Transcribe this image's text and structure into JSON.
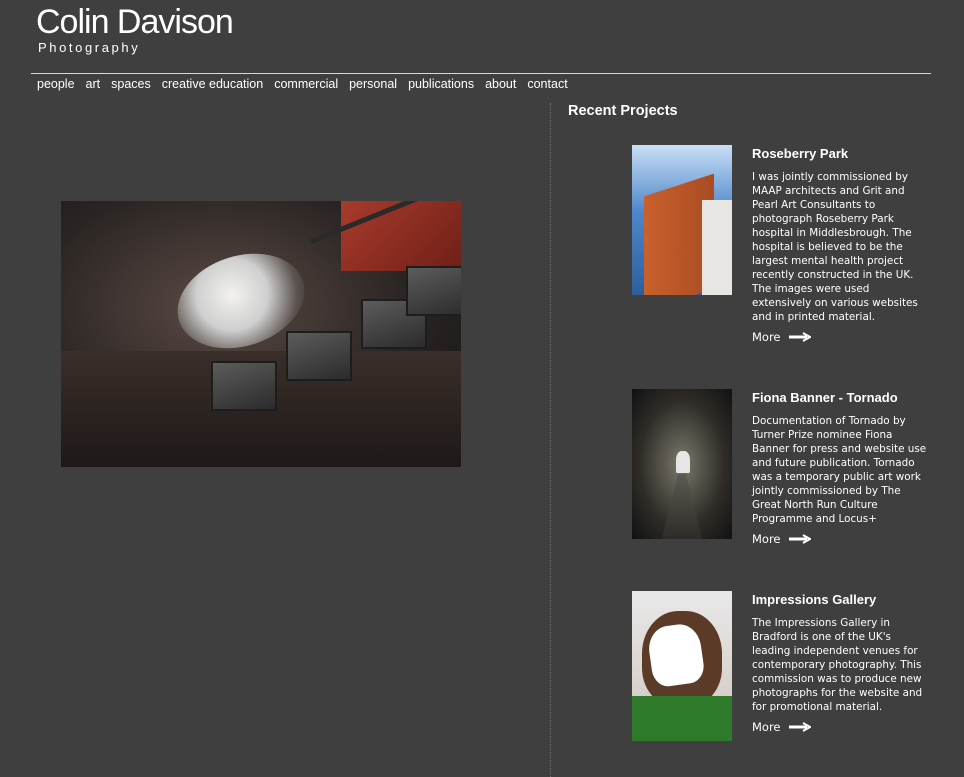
{
  "site": {
    "title": "Colin Davison",
    "subtitle": "Photography"
  },
  "nav": [
    "people",
    "art",
    "spaces",
    "creative education",
    "commercial",
    "personal",
    "publications",
    "about",
    "contact"
  ],
  "recent": {
    "heading": "Recent Projects",
    "more_label": "More",
    "projects": [
      {
        "title": "Roseberry Park",
        "desc": "I was jointly commissioned by MAAP architects and Grit and Pearl Art Consultants to photograph Roseberry Park hospital in Middlesbrough. The hospital is believed to be the largest mental health project recently constructed in the UK. The images were used extensively on various websites and in printed material."
      },
      {
        "title": "Fiona Banner - Tornado",
        "desc": "Documentation of Tornado by Turner Prize nominee Fiona Banner for press and website use and future publication. Tornado was a temporary public art work jointly commissioned by The Great North Run Culture Programme and Locus+"
      },
      {
        "title": "Impressions Gallery",
        "desc": "The Impressions Gallery in Bradford is one of the UK's leading independent venues for contemporary photography. This commission was to produce new photographs for the website and for promotional material."
      }
    ]
  },
  "icons": {
    "more": "arrow-right-icon"
  }
}
